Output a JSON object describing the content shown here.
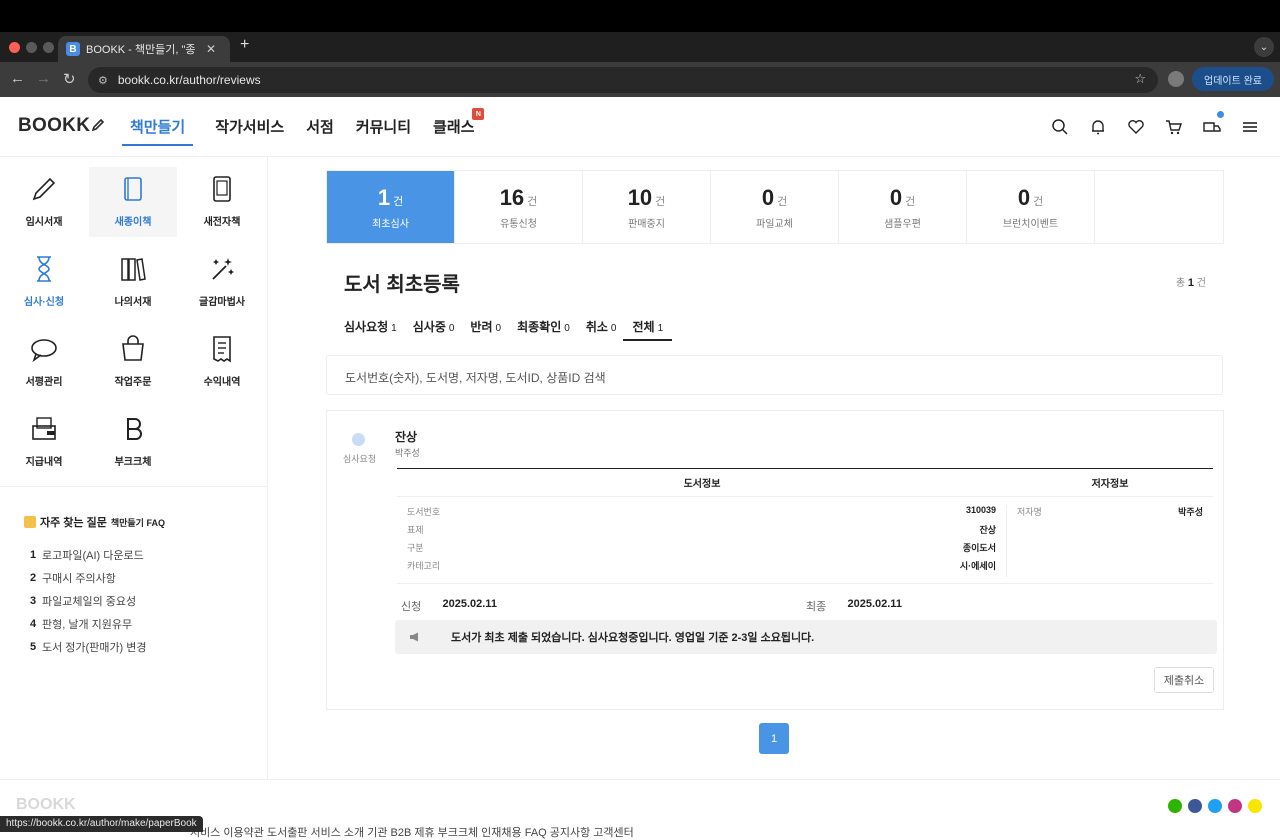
{
  "browser": {
    "tab_title": "BOOKK - 책만들기, \"종이책, 전자",
    "tab_favicon": "B",
    "url": "bookk.co.kr/author/reviews",
    "update_label": "업데이트 완료",
    "status_url": "https://bookk.co.kr/author/make/paperBook"
  },
  "header": {
    "logo": "BOOKK",
    "nav": [
      "책만들기",
      "작가서비스",
      "서점",
      "커뮤니티",
      "클래스"
    ],
    "class_badge": "N"
  },
  "sidebar": {
    "menu": [
      {
        "label": "임시서재",
        "icon": "pencil-icon"
      },
      {
        "label": "새종이책",
        "icon": "book-icon"
      },
      {
        "label": "새전자책",
        "icon": "tablet-icon"
      },
      {
        "label": "심사·신청",
        "icon": "hourglass-icon"
      },
      {
        "label": "나의서재",
        "icon": "books-icon"
      },
      {
        "label": "글감마법사",
        "icon": "magic-wand-icon"
      },
      {
        "label": "서평관리",
        "icon": "chat-bubble-icon"
      },
      {
        "label": "작업주문",
        "icon": "shopping-bag-icon"
      },
      {
        "label": "수익내역",
        "icon": "receipt-icon"
      },
      {
        "label": "지급내역",
        "icon": "wallet-icon"
      },
      {
        "label": "부크크체",
        "icon": "bookk-b-icon"
      }
    ],
    "faq_title": "자주 찾는 질문",
    "faq_sub": "책만들기 FAQ",
    "faq": [
      {
        "num": "1",
        "text": "로고파일(AI) 다운로드"
      },
      {
        "num": "2",
        "text": "구매시 주의사항"
      },
      {
        "num": "3",
        "text": "파일교체일의 중요성"
      },
      {
        "num": "4",
        "text": "판형, 날개 지원유무"
      },
      {
        "num": "5",
        "text": "도서 정가(판매가) 변경"
      }
    ]
  },
  "stats": [
    {
      "num": "1",
      "unit": "건",
      "label": "최초심사"
    },
    {
      "num": "16",
      "unit": "건",
      "label": "유통신청"
    },
    {
      "num": "10",
      "unit": "건",
      "label": "판매중지"
    },
    {
      "num": "0",
      "unit": "건",
      "label": "파일교체"
    },
    {
      "num": "0",
      "unit": "건",
      "label": "샘플우편"
    },
    {
      "num": "0",
      "unit": "건",
      "label": "브런치이벤트"
    }
  ],
  "main": {
    "title": "도서 최초등록",
    "total_prefix": "총",
    "total_num": "1",
    "total_unit": "건",
    "tabs": [
      {
        "label": "심사요청",
        "count": "1"
      },
      {
        "label": "심사중",
        "count": "0"
      },
      {
        "label": "반려",
        "count": "0"
      },
      {
        "label": "최종확인",
        "count": "0"
      },
      {
        "label": "취소",
        "count": "0"
      },
      {
        "label": "전체",
        "count": "1"
      }
    ],
    "search_placeholder": "도서번호(숫자), 도서명, 저자명, 도서ID, 상품ID 검색"
  },
  "card": {
    "status": "심사요청",
    "title": "잔상",
    "author": "박주성",
    "book_info_header": "도서정보",
    "author_info_header": "저자정보",
    "book_rows": [
      {
        "k": "도서번호",
        "v": "310039"
      },
      {
        "k": "표제",
        "v": "잔상"
      },
      {
        "k": "구분",
        "v": "종이도서"
      },
      {
        "k": "카테고리",
        "v": "시·에세이"
      }
    ],
    "author_rows": [
      {
        "k": "저자명",
        "v": "박주성"
      }
    ],
    "applied_label": "신청",
    "applied_date": "2025.02.11",
    "final_label": "최종",
    "final_date": "2025.02.11",
    "notice": "도서가 최초 제출 되었습니다. 심사요청중입니다. 영업일 기준 2-3일 소요됩니다.",
    "cancel_label": "제출취소"
  },
  "pagination": {
    "current": "1"
  },
  "footer": {
    "logo": "BOOKK",
    "links": "서비스 이용약관   도서출판   서비스 소개   기관 B2B 제휴   부크크체   인재채용   FAQ   공지사항   고객센터"
  },
  "colors": {
    "accent": "#4a94e6",
    "nav_active": "#2f7ad6",
    "badge": "#e04c3c"
  }
}
